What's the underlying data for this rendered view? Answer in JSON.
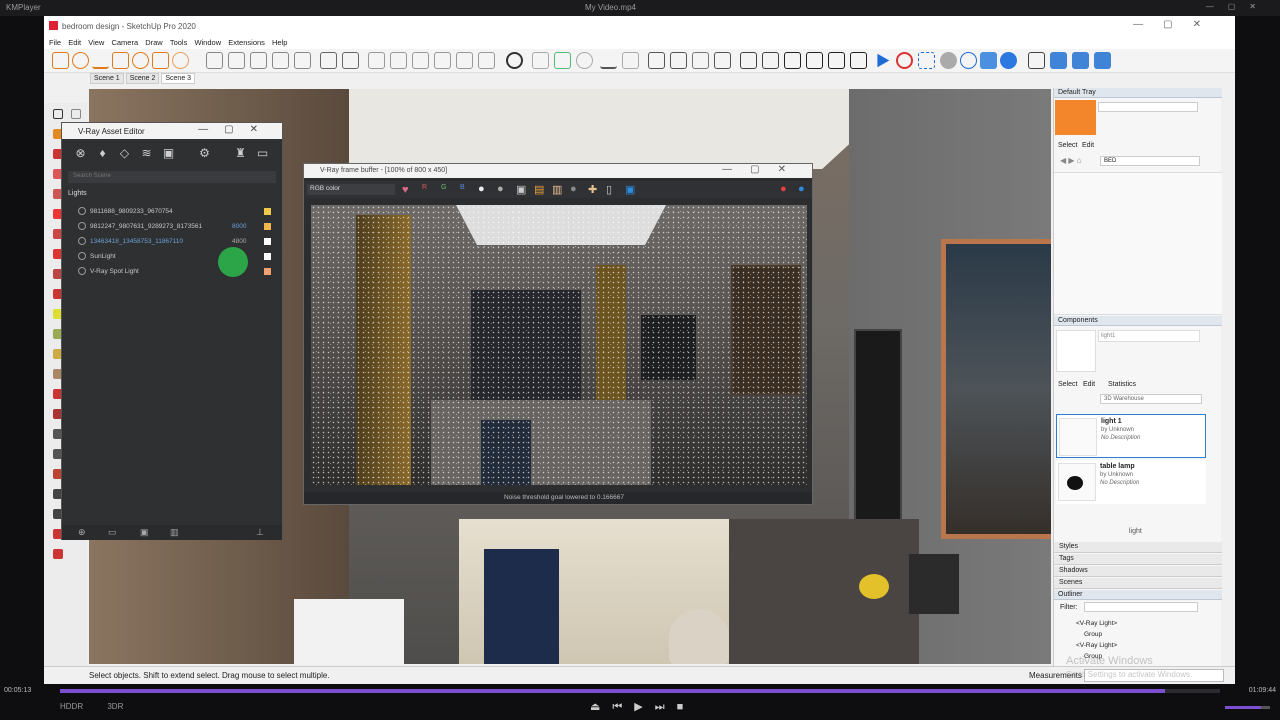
{
  "player": {
    "name": "KMPlayer",
    "file": "My Video.mp4",
    "time_current": "00:05:13",
    "time_total": "01:09:44",
    "progress": 0.953,
    "volume": 0.8,
    "btn_a": "HDDR",
    "btn_b": "3DR"
  },
  "sketchup": {
    "title": "bedroom design - SketchUp Pro 2020",
    "menu": [
      "File",
      "Edit",
      "View",
      "Camera",
      "Draw",
      "Tools",
      "Window",
      "Extensions",
      "Help"
    ],
    "scenes": [
      "Scene 1",
      "Scene 2",
      "Scene 3"
    ],
    "active_scene": "Scene 3",
    "status_message": "Select objects. Shift to extend select. Drag mouse to select multiple.",
    "measurements_label": "Measurements"
  },
  "asset_editor": {
    "title": "V-Ray Asset Editor",
    "search_placeholder": "Search Scene",
    "section": "Lights",
    "lights": [
      {
        "name": "9811688_9809233_9670754",
        "value": "",
        "color": "#f0c84a"
      },
      {
        "name": "9812247_9807631_9289273_8173561",
        "value": "8000",
        "color": "#f3b752"
      },
      {
        "name": "13463418_13458753_11867110",
        "value": "4800",
        "color": "#ffffff"
      },
      {
        "name": "SunLight",
        "value": "",
        "color": "#ffffff"
      },
      {
        "name": "V-Ray Spot Light",
        "value": "",
        "color": "#f0a070"
      }
    ]
  },
  "vfb": {
    "title": "V-Ray frame buffer - [100% of 800 x 450]",
    "channel": "RGB color",
    "status": "Noise threshold goal lowered to 0.166667"
  },
  "tray": {
    "title": "Default Tray",
    "swatch_color": "#f3852a",
    "material_tab_select": "Select",
    "material_tab_edit": "Edit",
    "material_name": "BED",
    "components_title": "Components",
    "component_name": "light1",
    "tab_select": "Select",
    "tab_edit": "Edit",
    "tab_statistics": "Statistics",
    "search_value": "3D Warehouse",
    "results": [
      {
        "name": "light 1",
        "by": "by Unknown",
        "desc": "No Description"
      },
      {
        "name": "table lamp",
        "by": "by Unknown",
        "desc": "No Description"
      }
    ],
    "search_term": "light",
    "collapsed": [
      "Styles",
      "Tags",
      "Shadows",
      "Scenes"
    ],
    "outliner_title": "Outliner",
    "filter_label": "Filter:",
    "outliner_rows": [
      "<V-Ray Light>",
      "Group",
      "<V-Ray Light>",
      "Group",
      "<V-Ray Light>"
    ]
  },
  "overlay": {
    "activate_1": "Activate Windows",
    "activate_2": "Go to Settings to activate Windows."
  }
}
